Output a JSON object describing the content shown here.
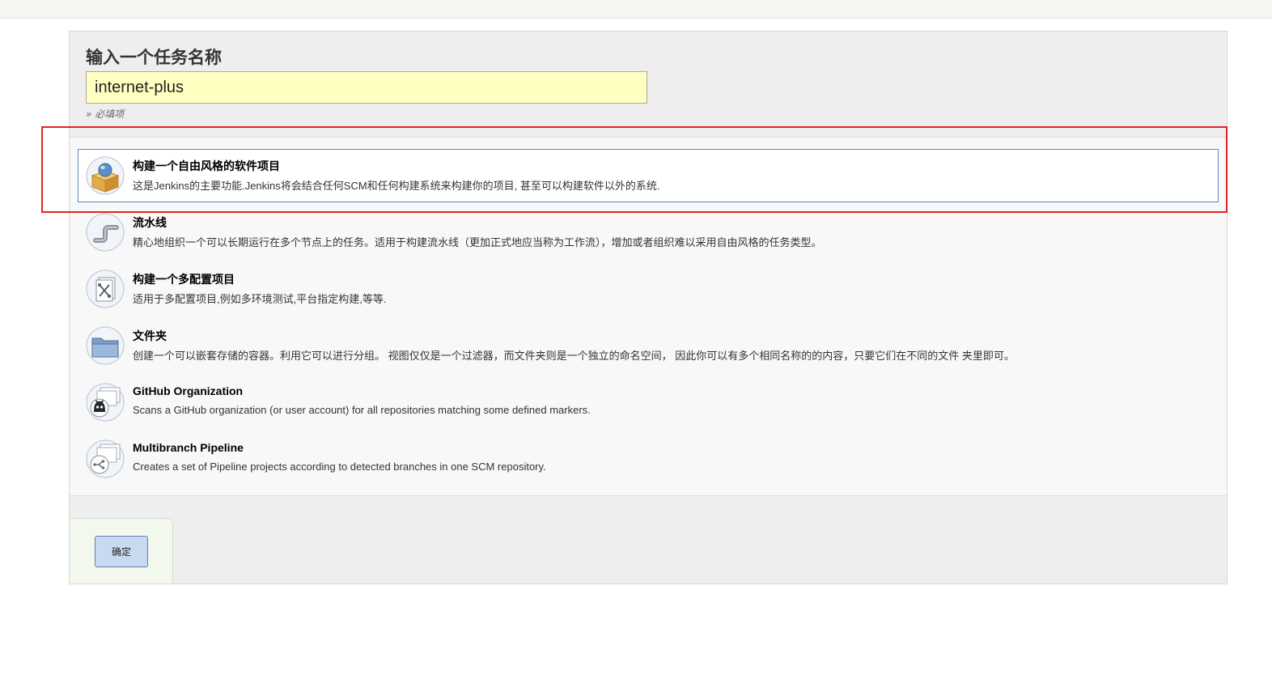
{
  "form": {
    "title": "输入一个任务名称",
    "input_value": "internet-plus",
    "required_hint": "» 必填项"
  },
  "items": [
    {
      "label": "构建一个自由风格的软件项目",
      "description": "这是Jenkins的主要功能.Jenkins将会结合任何SCM和任何构建系统来构建你的项目, 甚至可以构建软件以外的系统.",
      "icon": "freestyle-package-icon",
      "selected": true
    },
    {
      "label": "流水线",
      "description": "精心地组织一个可以长期运行在多个节点上的任务。适用于构建流水线（更加正式地应当称为工作流），增加或者组织难以采用自由风格的任务类型。",
      "icon": "pipeline-icon",
      "selected": false
    },
    {
      "label": "构建一个多配置项目",
      "description": "适用于多配置项目,例如多环境测试,平台指定构建,等等.",
      "icon": "multi-config-icon",
      "selected": false
    },
    {
      "label": "文件夹",
      "description": "创建一个可以嵌套存储的容器。利用它可以进行分组。 视图仅仅是一个过滤器，而文件夹则是一个独立的命名空间， 因此你可以有多个相同名称的的内容，只要它们在不同的文件 夹里即可。",
      "icon": "folder-icon",
      "selected": false
    },
    {
      "label": "GitHub Organization",
      "description": "Scans a GitHub organization (or user account) for all repositories matching some defined markers.",
      "icon": "github-organization-icon",
      "selected": false
    },
    {
      "label": "Multibranch Pipeline",
      "description": "Creates a set of Pipeline projects according to detected branches in one SCM repository.",
      "icon": "multibranch-pipeline-icon",
      "selected": false
    }
  ],
  "footer": {
    "ok_label": "确定"
  },
  "colors": {
    "input_background": "#ffffc0",
    "selected_border": "#5f88b8",
    "highlight_annotation": "#e02424",
    "ok_button_background": "#c9daf0"
  }
}
